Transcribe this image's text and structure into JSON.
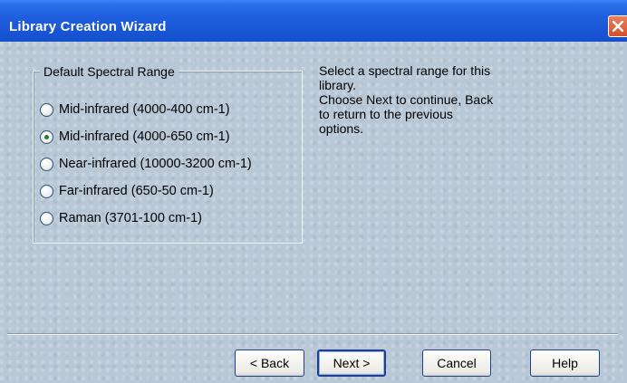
{
  "window": {
    "title": "Library Creation Wizard"
  },
  "group": {
    "label": "Default Spectral Range",
    "options": [
      {
        "label": "Mid-infrared (4000-400 cm-1)",
        "checked": false
      },
      {
        "label": "Mid-infrared (4000-650 cm-1)",
        "checked": true
      },
      {
        "label": "Near-infrared (10000-3200 cm-1)",
        "checked": false
      },
      {
        "label": "Far-infrared (650-50 cm-1)",
        "checked": false
      },
      {
        "label": "Raman (3701-100 cm-1)",
        "checked": false
      }
    ]
  },
  "instructions": {
    "lines": [
      "Select a spectral range for this",
      "library.",
      "Choose Next to continue, Back",
      "to return to the previous",
      "options."
    ]
  },
  "buttons": {
    "back": "< Back",
    "next": "Next >",
    "cancel": "Cancel",
    "help": "Help"
  },
  "colors": {
    "titlebar": "#1f5fde",
    "dialog_background": "#b9c8d6",
    "selected_radio_dot": "#1e7c2e"
  }
}
